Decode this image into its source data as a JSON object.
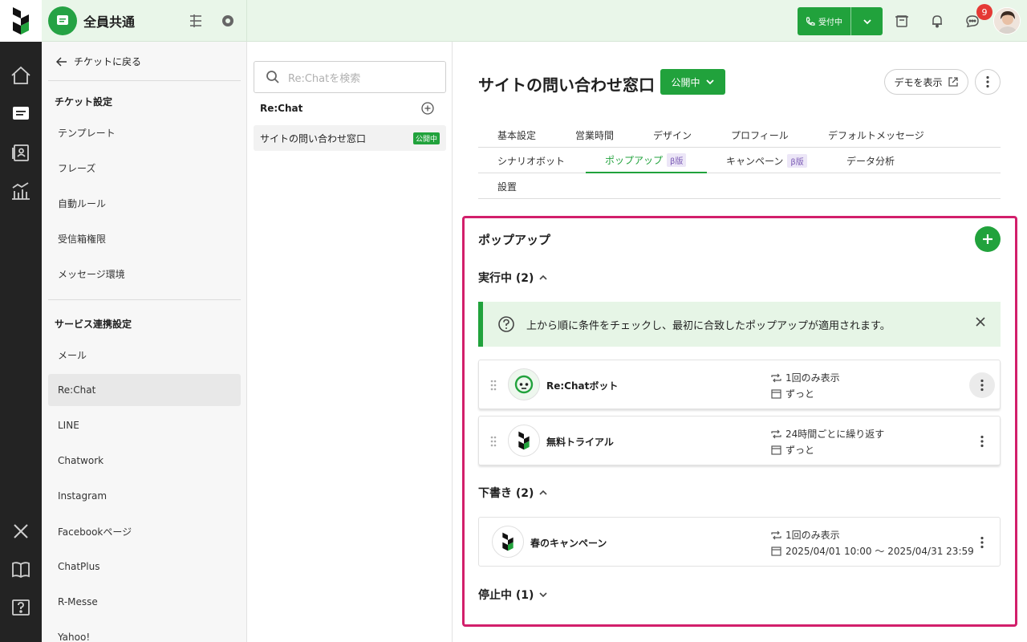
{
  "topbar": {
    "workspace_name": "全員共通",
    "receive_label": "受付中",
    "notification_count": "9"
  },
  "nav": {
    "back_label": "チケットに戻る",
    "ticket_heading": "チケット設定",
    "ticket_items": [
      "テンプレート",
      "フレーズ",
      "自動ルール",
      "受信箱権限",
      "メッセージ環境"
    ],
    "service_heading": "サービス連携設定",
    "service_items": [
      "メール",
      "Re:Chat",
      "LINE",
      "Chatwork",
      "Instagram",
      "Facebookページ",
      "ChatPlus",
      "R-Messe",
      "Yahoo!"
    ],
    "active_item": "Re:Chat"
  },
  "list": {
    "search_placeholder": "Re:Chatを検索",
    "title": "Re:Chat",
    "row_label": "サイトの問い合わせ窓口",
    "row_badge": "公開中"
  },
  "main": {
    "title": "サイトの問い合わせ窓口",
    "status_label": "公開中",
    "demo_label": "デモを表示",
    "tabs_row1": [
      "基本設定",
      "営業時間",
      "デザイン",
      "プロフィール",
      "デフォルトメッセージ"
    ],
    "tabs_row2": [
      "シナリオボット",
      "ポップアップ",
      "キャンペーン",
      "データ分析"
    ],
    "tabs_row3": [
      "設置"
    ],
    "beta_label": "β版",
    "active_tab": "ポップアップ"
  },
  "panel": {
    "title": "ポップアップ",
    "running_heading": "実行中 (2)",
    "info_text": "上から順に条件をチェックし、最初に合致したポップアップが適用されます。",
    "draft_heading": "下書き (2)",
    "stopped_heading": "停止中 (1)",
    "running_cards": [
      {
        "name": "Re:Chatボット",
        "repeat": "1回のみ表示",
        "period": "ずっと"
      },
      {
        "name": "無料トライアル",
        "repeat": "24時間ごとに繰り返す",
        "period": "ずっと"
      }
    ],
    "draft_cards": [
      {
        "name": "春のキャンペーン",
        "repeat": "1回のみ表示",
        "period": "2025/04/01 10:00 〜 2025/04/31 23:59"
      }
    ]
  },
  "colors": {
    "brand_green": "#21a23c",
    "highlight_border": "#d21f6b",
    "rail_bg": "#232323"
  }
}
